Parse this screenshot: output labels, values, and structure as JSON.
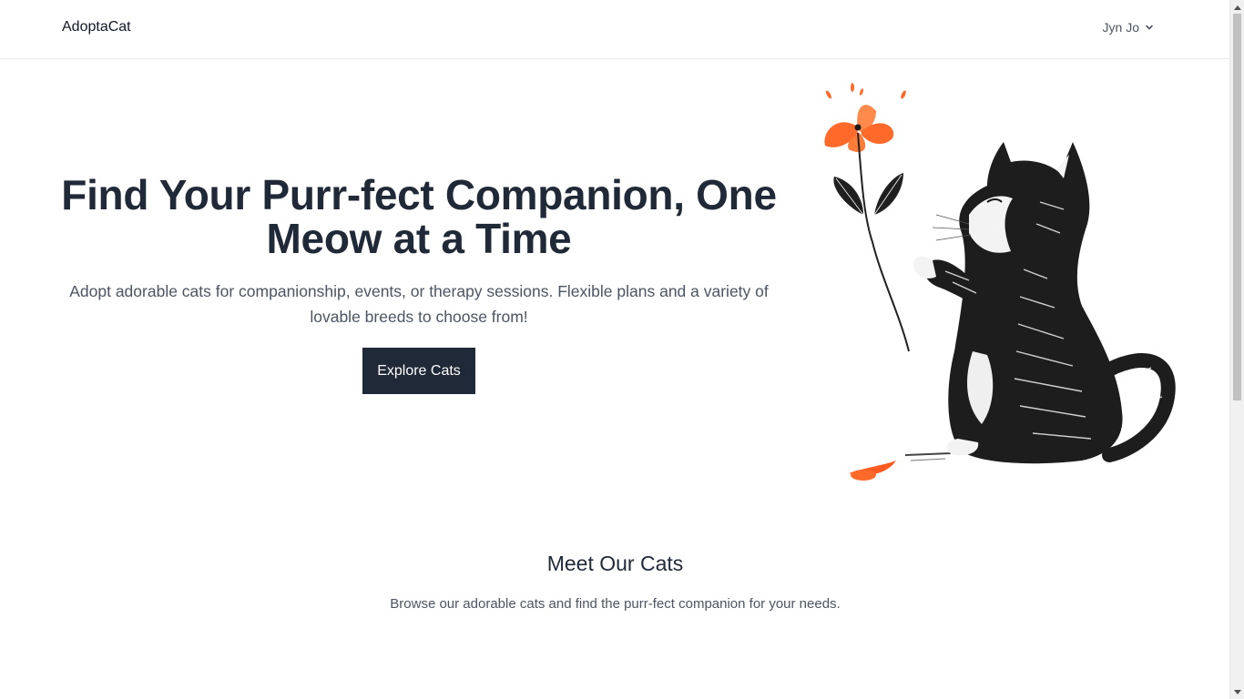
{
  "header": {
    "brand": "AdoptaCat",
    "user_name": "Jyn Jo"
  },
  "hero": {
    "title": "Find Your Purr-fect Companion, One Meow at a Time",
    "subtitle": "Adopt adorable cats for companionship, events, or therapy sessions. Flexible plans and a variety of lovable breeds to choose from!",
    "cta_label": "Explore Cats",
    "illustration_icon": "cat-with-flower-illustration"
  },
  "meet": {
    "title": "Meet Our Cats",
    "subtitle": "Browse our adorable cats and find the purr-fect companion for your needs."
  },
  "colors": {
    "primary": "#1f2937",
    "text_muted": "#4b5563",
    "flower_orange": "#ff6a2b",
    "border": "#ececec"
  }
}
